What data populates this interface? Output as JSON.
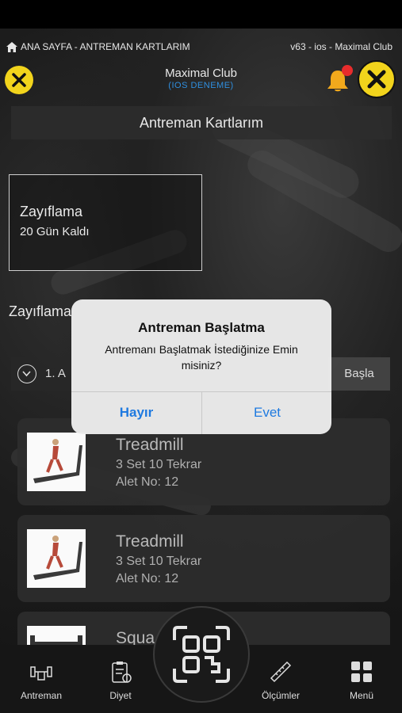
{
  "breadcrumb": {
    "text": "ANA SAYFA - ANTREMAN KARTLARIM"
  },
  "version_info": "v63 - ios -  Maximal Club",
  "header": {
    "title": "Maximal Club",
    "subtitle": "(IOS DENEME)"
  },
  "section_title": "Antreman Kartlarım",
  "plan_card": {
    "name": "Zayıflama",
    "remaining": "20 Gün Kaldı"
  },
  "plan_heading": "Zayıflama",
  "day_row": {
    "label": "1. A",
    "start_label": "Başla"
  },
  "exercises": [
    {
      "name": "Treadmill",
      "sets": "3 Set 10 Tekrar",
      "alet": "Alet No: 12"
    },
    {
      "name": "Treadmill",
      "sets": "3 Set 10 Tekrar",
      "alet": "Alet No: 12"
    },
    {
      "name": "Squa"
    }
  ],
  "dialog": {
    "title": "Antreman Başlatma",
    "message": "Antremanı Başlatmak İstediğinize Emin misiniz?",
    "no_label": "Hayır",
    "yes_label": "Evet"
  },
  "bottom_nav": {
    "antreman": "Antreman",
    "diyet": "Diyet",
    "olcumler": "Ölçümler",
    "menu": "Menü"
  },
  "colors": {
    "brand_yellow": "#f2d41c",
    "link_blue": "#1f7ae0",
    "notification_red": "#e82c2c"
  }
}
